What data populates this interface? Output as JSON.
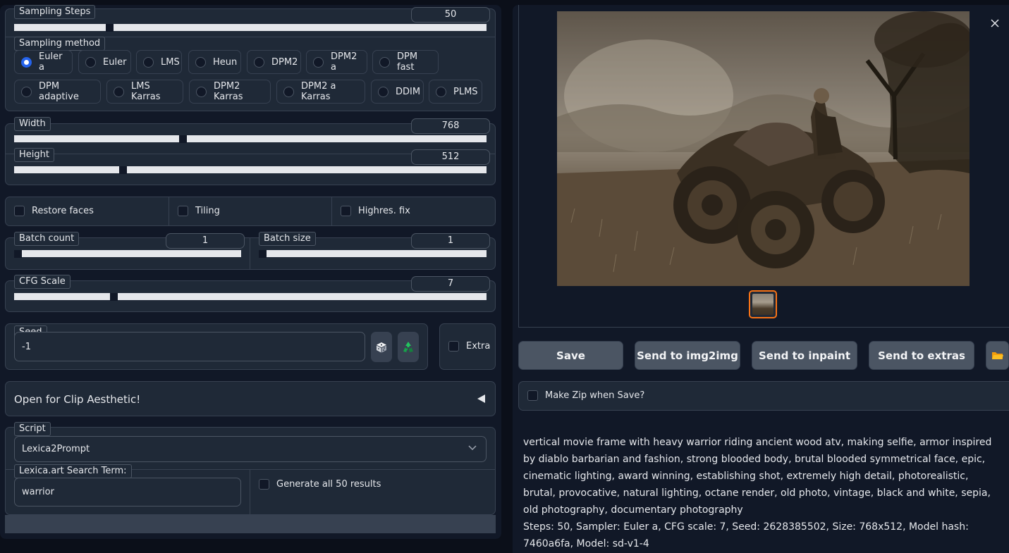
{
  "sampling_steps": {
    "label": "Sampling Steps",
    "value": "50",
    "fraction": 0.27
  },
  "sampling_method": {
    "label": "Sampling method",
    "options": [
      "Euler a",
      "Euler",
      "LMS",
      "Heun",
      "DPM2",
      "DPM2 a",
      "DPM fast",
      "DPM adaptive",
      "LMS Karras",
      "DPM2 Karras",
      "DPM2 a Karras",
      "DDIM",
      "PLMS"
    ],
    "selected": "Euler a"
  },
  "width": {
    "label": "Width",
    "value": "768",
    "fraction": 0.36
  },
  "height": {
    "label": "Height",
    "value": "512",
    "fraction": 0.22
  },
  "checkboxes": {
    "restore_faces": "Restore faces",
    "tiling": "Tiling",
    "highres_fix": "Highres. fix"
  },
  "batch_count": {
    "label": "Batch count",
    "value": "1",
    "fraction": 0.0
  },
  "batch_size": {
    "label": "Batch size",
    "value": "1",
    "fraction": 0.0
  },
  "cfg_scale": {
    "label": "CFG Scale",
    "value": "7",
    "fraction": 0.21
  },
  "seed": {
    "label": "Seed",
    "value": "-1",
    "extra_label": "Extra"
  },
  "clip_aesthetic": {
    "label": "Open for Clip Aesthetic!"
  },
  "script": {
    "label": "Script",
    "selected": "Lexica2Prompt"
  },
  "lexica": {
    "label": "Lexica.art Search Term:",
    "value": "warrior",
    "generate_all_label": "Generate all 50 results"
  },
  "actions": {
    "save": "Save",
    "img2img": "Send to img2img",
    "inpaint": "Send to inpaint",
    "extras": "Send to extras"
  },
  "make_zip": "Make Zip when Save?",
  "output_text": {
    "prompt": "vertical movie frame with heavy warrior riding ancient wood atv, making selfie, armor inspired by diablo barbarian and fashion, strong blooded body, brutal blooded symmetrical face, epic, cinematic lighting, award winning, establishing shot, extremely high detail, photorealistic, brutal, provocative, natural lighting, octane render, old photo, vintage, black and white, sepia, old photography, documentary photography",
    "params": "Steps: 50, Sampler: Euler a, CFG scale: 7, Seed: 2628385502, Size: 768x512, Model hash: 7460a6fa, Model: sd-v1-4"
  },
  "icons": {
    "close": "close-icon",
    "dice": "dice-icon",
    "recycle": "recycle-icon",
    "folder": "folder-icon",
    "collapse": "triangle-left-icon",
    "dropdown": "chevron-down-icon"
  },
  "colors": {
    "accent": "#2563eb",
    "thumb_border": "#f97316"
  }
}
